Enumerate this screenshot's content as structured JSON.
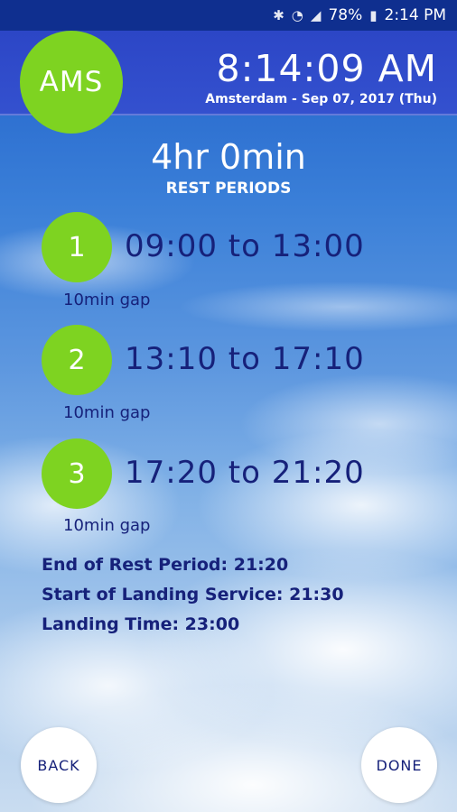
{
  "status_bar": {
    "icons": [
      "bluetooth-icon",
      "wifi-icon",
      "signal-icon",
      "battery-icon"
    ],
    "battery": "78%",
    "time": "2:14 PM"
  },
  "header": {
    "airport_code": "AMS",
    "clock": "8:14:09 AM",
    "date": "Amsterdam - Sep 07, 2017 (Thu)"
  },
  "summary_header": {
    "duration": "4hr 0min",
    "label": "REST PERIODS"
  },
  "periods": [
    {
      "number": "1",
      "range": "09:00 to 13:00",
      "gap": "10min gap"
    },
    {
      "number": "2",
      "range": "13:10 to 17:10",
      "gap": "10min gap"
    },
    {
      "number": "3",
      "range": "17:20 to 21:20",
      "gap": "10min gap"
    }
  ],
  "details": {
    "end_rest": "End of Rest Period: 21:20",
    "start_landing": "Start of Landing Service: 21:30",
    "landing_time": "Landing Time: 23:00"
  },
  "buttons": {
    "back": "BACK",
    "done": "DONE"
  },
  "colors": {
    "accent_green": "#7ed321",
    "header_blue": "#3550cf",
    "text_navy": "#16217a"
  }
}
